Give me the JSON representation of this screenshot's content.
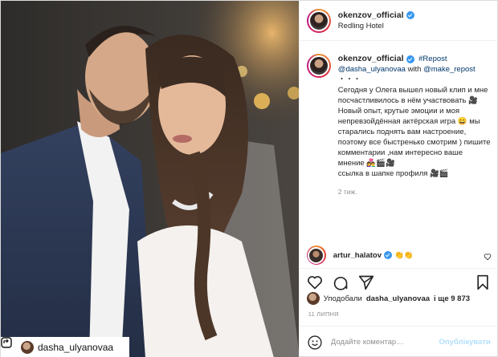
{
  "header": {
    "username": "okenzov_official",
    "location": "Redling Hotel"
  },
  "caption": {
    "username": "okenzov_official",
    "repost": "#Repost",
    "mention_user": "@dasha_ulyanovaa",
    "with": "with",
    "mention_app": "@make_repost",
    "dots": "・・・",
    "line1": "Сегодня у Олега вышел новый клип и мне посчастливилось в нём участвовать 🎥",
    "line2": "Новый опыт, крутые эмоции и моя непревзойдённая актёрская игра 😄 мы старались поднять вам настроение, поэтому все быстренько смотрим ) пишите комментарии ,нам интересно ваше мнение 👩‍❤️‍👨🎬🎥",
    "line3": "ссылка в шапке профиля 🎥🎬",
    "time": "2 тиж."
  },
  "comment": {
    "username": "artur_halatov",
    "text": "👏👏"
  },
  "likes": {
    "prefix": "Уподобали",
    "user": "dasha_ulyanovaa",
    "suffix": "і ще 9 873"
  },
  "date": "11 ЛИПНЯ",
  "add_comment": {
    "placeholder": "Додайте коментар…",
    "publish": "Опублікувати"
  },
  "repost_tag": {
    "username": "dasha_ulyanovaa"
  },
  "icons": [
    "verified-icon",
    "heart-icon",
    "comment-icon",
    "share-icon",
    "bookmark-icon",
    "smile-icon",
    "repost-icon"
  ],
  "colors": {
    "link": "#00376b",
    "verified": "#3897f0",
    "publish_disabled": "#b2dffc",
    "muted": "#8e8e8e"
  }
}
